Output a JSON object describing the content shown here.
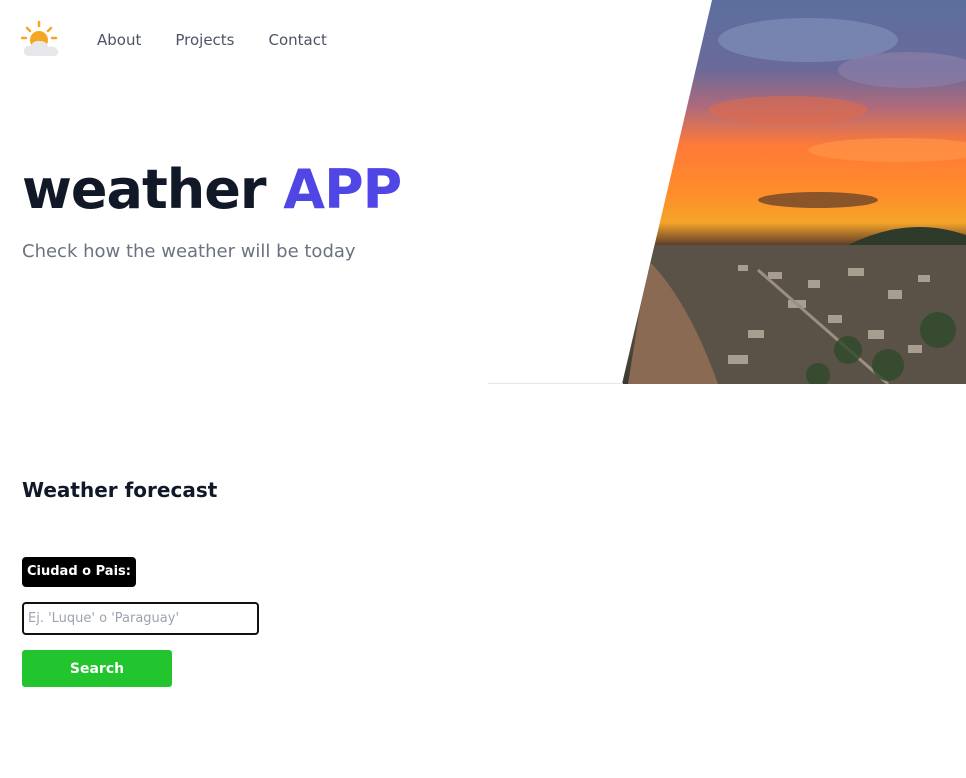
{
  "header": {
    "logo_icon": "sun-behind-cloud-icon",
    "nav": [
      {
        "label": "About"
      },
      {
        "label": "Projects"
      },
      {
        "label": "Contact"
      }
    ]
  },
  "hero": {
    "title_main": "weather",
    "title_accent": "APP",
    "subtitle": "Check how the weather will be today",
    "image_description_icon": "sunset-coastal-town-photo"
  },
  "forecast": {
    "title": "Weather forecast",
    "city_label": "Ciudad o Pais:",
    "input_value": "",
    "input_placeholder": "Ej. 'Luque' o 'Paraguay'",
    "search_label": "Search"
  },
  "colors": {
    "accent": "#4f46e5",
    "search_button": "#22c52e",
    "text_dark": "#111827",
    "text_muted": "#6b7280"
  }
}
